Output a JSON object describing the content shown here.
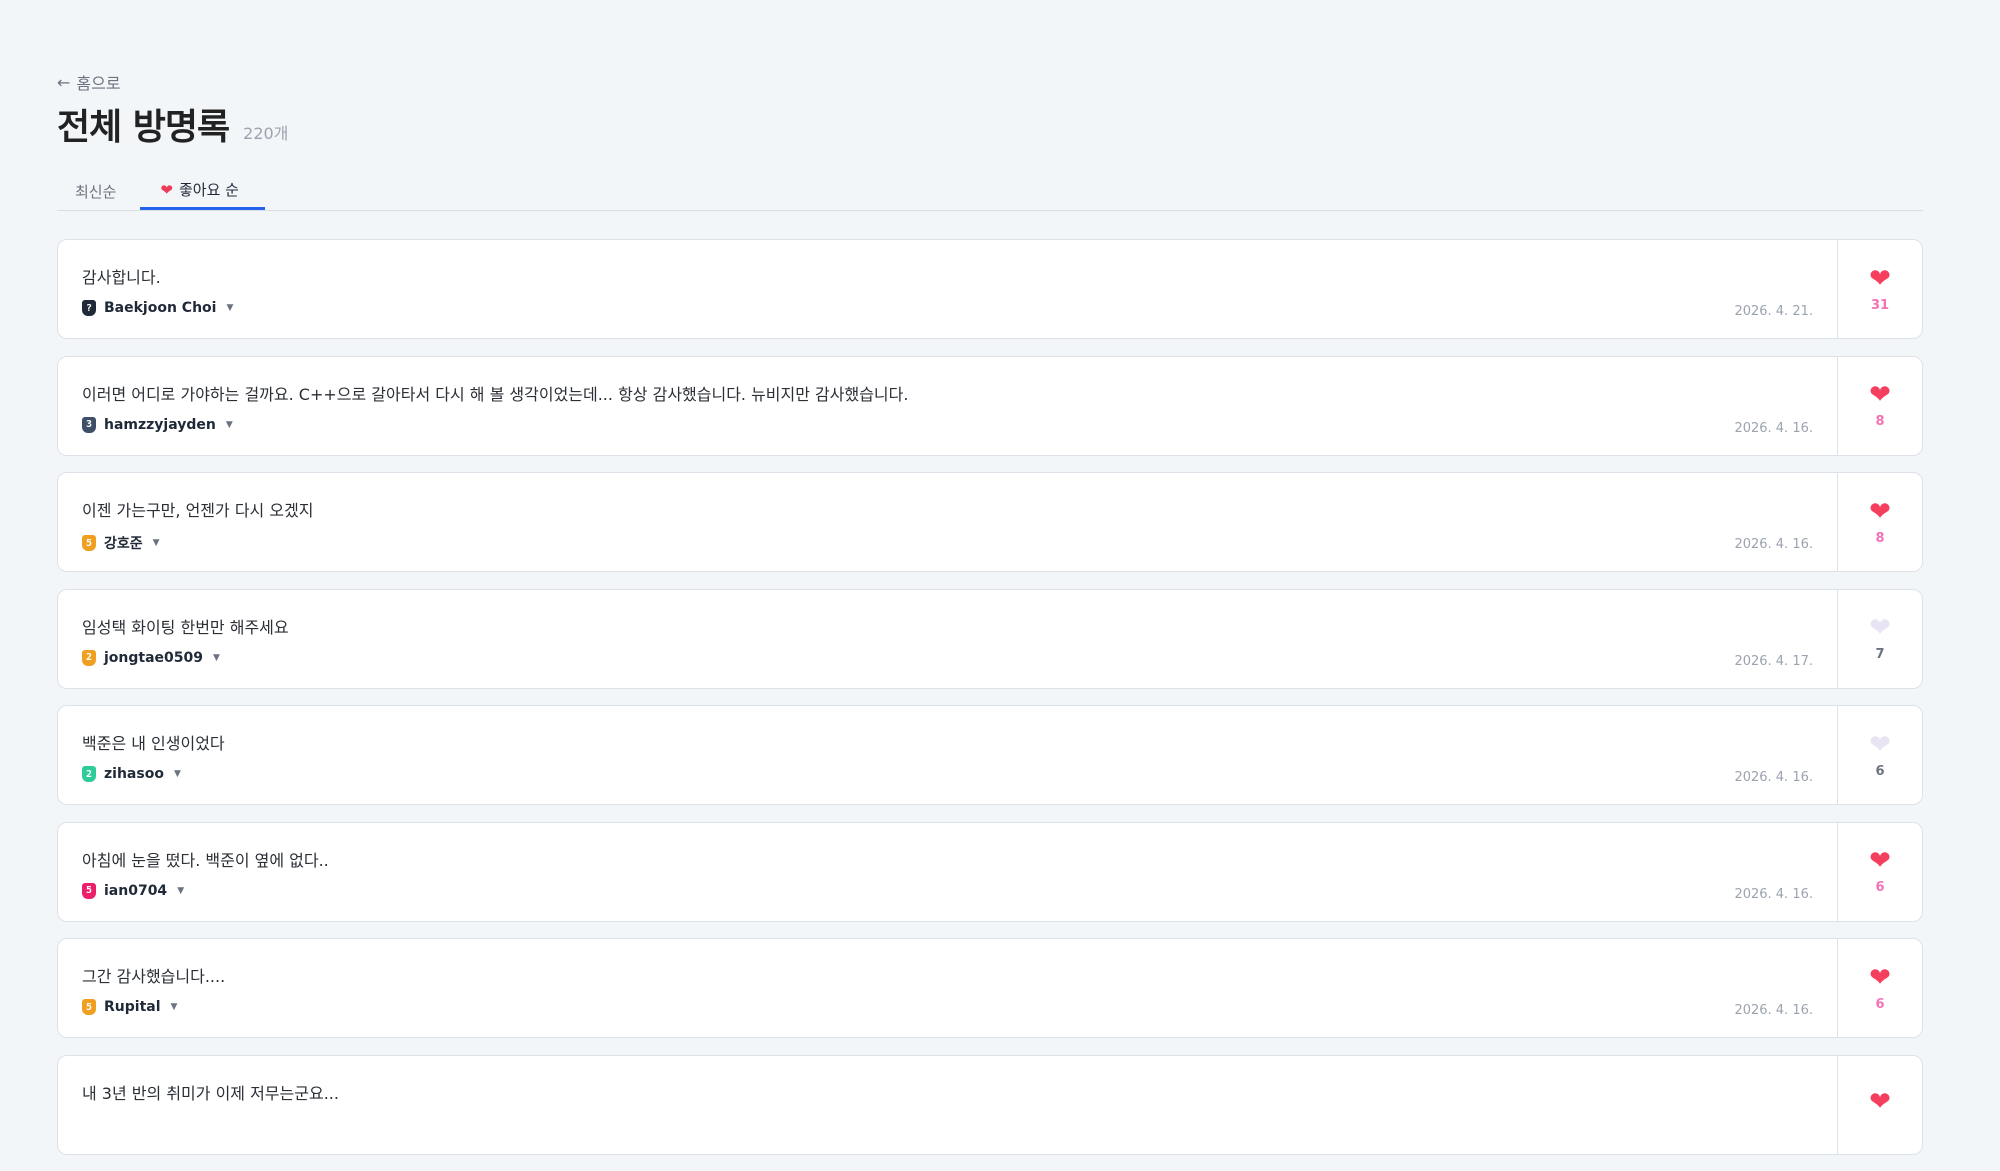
{
  "nav": {
    "back_arrow": "←",
    "back_label": "홈으로"
  },
  "header": {
    "title": "전체 방명록",
    "count": "220개"
  },
  "tabs": [
    {
      "label": "최신순",
      "active": false
    },
    {
      "label": "좋아요 순",
      "active": true,
      "icon": "heart-icon"
    }
  ],
  "entries": [
    {
      "message": "감사합니다.",
      "author": "Baekjoon Choi",
      "badge": "?",
      "badge_color": "#1f2937",
      "date": "2026. 4. 21.",
      "likes": "31",
      "liked": true
    },
    {
      "message": "이러면 어디로 가야하는 걸까요. C++으로 갈아타서 다시 해 볼 생각이었는데... 항상 감사했습니다. 뉴비지만 감사했습니다.",
      "author": "hamzzyjayden",
      "badge": "3",
      "badge_color": "#3d4f66",
      "date": "2026. 4. 16.",
      "likes": "8",
      "liked": true
    },
    {
      "message": "이젠 가는구만, 언젠가 다시 오겠지",
      "author": "강호준",
      "badge": "5",
      "badge_color": "#f0a020",
      "date": "2026. 4. 16.",
      "likes": "8",
      "liked": true
    },
    {
      "message": "임성택 화이팅 한번만 해주세요",
      "author": "jongtae0509",
      "badge": "2",
      "badge_color": "#f0a020",
      "date": "2026. 4. 17.",
      "likes": "7",
      "liked": false
    },
    {
      "message": "백준은 내 인생이었다",
      "author": "zihasoo",
      "badge": "2",
      "badge_color": "#2ecc9a",
      "date": "2026. 4. 16.",
      "likes": "6",
      "liked": false
    },
    {
      "message": "아침에 눈을 떴다. 백준이 옆에 없다..",
      "author": "ian0704",
      "badge": "5",
      "badge_color": "#ec1f6a",
      "date": "2026. 4. 16.",
      "likes": "6",
      "liked": true
    },
    {
      "message": "그간 감사했습니다....",
      "author": "Rupital",
      "badge": "5",
      "badge_color": "#f0a020",
      "date": "2026. 4. 16.",
      "likes": "6",
      "liked": true
    },
    {
      "message": "내 3년 반의 취미가 이제 저무는군요...",
      "author": "",
      "badge": "",
      "badge_color": "#f0a020",
      "date": "",
      "likes": "",
      "liked": true
    }
  ]
}
